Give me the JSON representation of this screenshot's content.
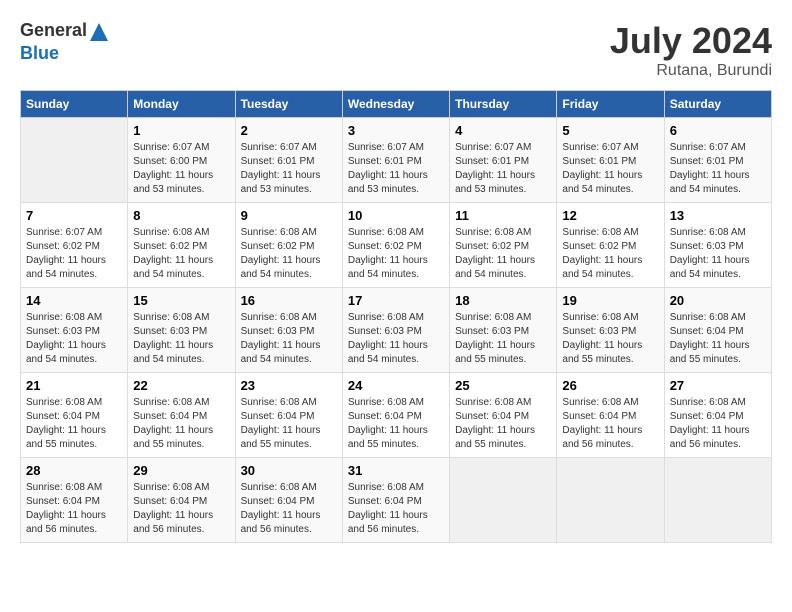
{
  "header": {
    "logo_general": "General",
    "logo_blue": "Blue",
    "month_year": "July 2024",
    "location": "Rutana, Burundi"
  },
  "days_of_week": [
    "Sunday",
    "Monday",
    "Tuesday",
    "Wednesday",
    "Thursday",
    "Friday",
    "Saturday"
  ],
  "weeks": [
    [
      {
        "day": "",
        "empty": true
      },
      {
        "day": "1",
        "sunrise": "Sunrise: 6:07 AM",
        "sunset": "Sunset: 6:00 PM",
        "daylight": "Daylight: 11 hours and 53 minutes."
      },
      {
        "day": "2",
        "sunrise": "Sunrise: 6:07 AM",
        "sunset": "Sunset: 6:01 PM",
        "daylight": "Daylight: 11 hours and 53 minutes."
      },
      {
        "day": "3",
        "sunrise": "Sunrise: 6:07 AM",
        "sunset": "Sunset: 6:01 PM",
        "daylight": "Daylight: 11 hours and 53 minutes."
      },
      {
        "day": "4",
        "sunrise": "Sunrise: 6:07 AM",
        "sunset": "Sunset: 6:01 PM",
        "daylight": "Daylight: 11 hours and 53 minutes."
      },
      {
        "day": "5",
        "sunrise": "Sunrise: 6:07 AM",
        "sunset": "Sunset: 6:01 PM",
        "daylight": "Daylight: 11 hours and 54 minutes."
      },
      {
        "day": "6",
        "sunrise": "Sunrise: 6:07 AM",
        "sunset": "Sunset: 6:01 PM",
        "daylight": "Daylight: 11 hours and 54 minutes."
      }
    ],
    [
      {
        "day": "7",
        "sunrise": "Sunrise: 6:07 AM",
        "sunset": "Sunset: 6:02 PM",
        "daylight": "Daylight: 11 hours and 54 minutes."
      },
      {
        "day": "8",
        "sunrise": "Sunrise: 6:08 AM",
        "sunset": "Sunset: 6:02 PM",
        "daylight": "Daylight: 11 hours and 54 minutes."
      },
      {
        "day": "9",
        "sunrise": "Sunrise: 6:08 AM",
        "sunset": "Sunset: 6:02 PM",
        "daylight": "Daylight: 11 hours and 54 minutes."
      },
      {
        "day": "10",
        "sunrise": "Sunrise: 6:08 AM",
        "sunset": "Sunset: 6:02 PM",
        "daylight": "Daylight: 11 hours and 54 minutes."
      },
      {
        "day": "11",
        "sunrise": "Sunrise: 6:08 AM",
        "sunset": "Sunset: 6:02 PM",
        "daylight": "Daylight: 11 hours and 54 minutes."
      },
      {
        "day": "12",
        "sunrise": "Sunrise: 6:08 AM",
        "sunset": "Sunset: 6:02 PM",
        "daylight": "Daylight: 11 hours and 54 minutes."
      },
      {
        "day": "13",
        "sunrise": "Sunrise: 6:08 AM",
        "sunset": "Sunset: 6:03 PM",
        "daylight": "Daylight: 11 hours and 54 minutes."
      }
    ],
    [
      {
        "day": "14",
        "sunrise": "Sunrise: 6:08 AM",
        "sunset": "Sunset: 6:03 PM",
        "daylight": "Daylight: 11 hours and 54 minutes."
      },
      {
        "day": "15",
        "sunrise": "Sunrise: 6:08 AM",
        "sunset": "Sunset: 6:03 PM",
        "daylight": "Daylight: 11 hours and 54 minutes."
      },
      {
        "day": "16",
        "sunrise": "Sunrise: 6:08 AM",
        "sunset": "Sunset: 6:03 PM",
        "daylight": "Daylight: 11 hours and 54 minutes."
      },
      {
        "day": "17",
        "sunrise": "Sunrise: 6:08 AM",
        "sunset": "Sunset: 6:03 PM",
        "daylight": "Daylight: 11 hours and 54 minutes."
      },
      {
        "day": "18",
        "sunrise": "Sunrise: 6:08 AM",
        "sunset": "Sunset: 6:03 PM",
        "daylight": "Daylight: 11 hours and 55 minutes."
      },
      {
        "day": "19",
        "sunrise": "Sunrise: 6:08 AM",
        "sunset": "Sunset: 6:03 PM",
        "daylight": "Daylight: 11 hours and 55 minutes."
      },
      {
        "day": "20",
        "sunrise": "Sunrise: 6:08 AM",
        "sunset": "Sunset: 6:04 PM",
        "daylight": "Daylight: 11 hours and 55 minutes."
      }
    ],
    [
      {
        "day": "21",
        "sunrise": "Sunrise: 6:08 AM",
        "sunset": "Sunset: 6:04 PM",
        "daylight": "Daylight: 11 hours and 55 minutes."
      },
      {
        "day": "22",
        "sunrise": "Sunrise: 6:08 AM",
        "sunset": "Sunset: 6:04 PM",
        "daylight": "Daylight: 11 hours and 55 minutes."
      },
      {
        "day": "23",
        "sunrise": "Sunrise: 6:08 AM",
        "sunset": "Sunset: 6:04 PM",
        "daylight": "Daylight: 11 hours and 55 minutes."
      },
      {
        "day": "24",
        "sunrise": "Sunrise: 6:08 AM",
        "sunset": "Sunset: 6:04 PM",
        "daylight": "Daylight: 11 hours and 55 minutes."
      },
      {
        "day": "25",
        "sunrise": "Sunrise: 6:08 AM",
        "sunset": "Sunset: 6:04 PM",
        "daylight": "Daylight: 11 hours and 55 minutes."
      },
      {
        "day": "26",
        "sunrise": "Sunrise: 6:08 AM",
        "sunset": "Sunset: 6:04 PM",
        "daylight": "Daylight: 11 hours and 56 minutes."
      },
      {
        "day": "27",
        "sunrise": "Sunrise: 6:08 AM",
        "sunset": "Sunset: 6:04 PM",
        "daylight": "Daylight: 11 hours and 56 minutes."
      }
    ],
    [
      {
        "day": "28",
        "sunrise": "Sunrise: 6:08 AM",
        "sunset": "Sunset: 6:04 PM",
        "daylight": "Daylight: 11 hours and 56 minutes."
      },
      {
        "day": "29",
        "sunrise": "Sunrise: 6:08 AM",
        "sunset": "Sunset: 6:04 PM",
        "daylight": "Daylight: 11 hours and 56 minutes."
      },
      {
        "day": "30",
        "sunrise": "Sunrise: 6:08 AM",
        "sunset": "Sunset: 6:04 PM",
        "daylight": "Daylight: 11 hours and 56 minutes."
      },
      {
        "day": "31",
        "sunrise": "Sunrise: 6:08 AM",
        "sunset": "Sunset: 6:04 PM",
        "daylight": "Daylight: 11 hours and 56 minutes."
      },
      {
        "day": "",
        "empty": true
      },
      {
        "day": "",
        "empty": true
      },
      {
        "day": "",
        "empty": true
      }
    ]
  ]
}
